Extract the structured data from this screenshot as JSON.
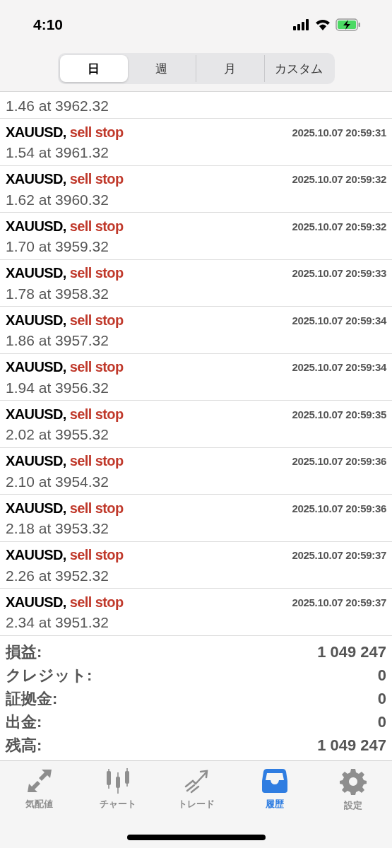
{
  "status_bar": {
    "time": "4:10"
  },
  "period_tabs": [
    {
      "label": "日",
      "selected": true
    },
    {
      "label": "週",
      "selected": false
    },
    {
      "label": "月",
      "selected": false
    },
    {
      "label": "カスタム",
      "selected": false
    }
  ],
  "orders": [
    {
      "details": "1.46 at 3962.32"
    },
    {
      "symbol": "XAUUSD,",
      "type": "sell stop",
      "time": "2025.10.07 20:59:31",
      "details": "1.54 at 3961.32"
    },
    {
      "symbol": "XAUUSD,",
      "type": "sell stop",
      "time": "2025.10.07 20:59:32",
      "details": "1.62 at 3960.32"
    },
    {
      "symbol": "XAUUSD,",
      "type": "sell stop",
      "time": "2025.10.07 20:59:32",
      "details": "1.70 at 3959.32"
    },
    {
      "symbol": "XAUUSD,",
      "type": "sell stop",
      "time": "2025.10.07 20:59:33",
      "details": "1.78 at 3958.32"
    },
    {
      "symbol": "XAUUSD,",
      "type": "sell stop",
      "time": "2025.10.07 20:59:34",
      "details": "1.86 at 3957.32"
    },
    {
      "symbol": "XAUUSD,",
      "type": "sell stop",
      "time": "2025.10.07 20:59:34",
      "details": "1.94 at 3956.32"
    },
    {
      "symbol": "XAUUSD,",
      "type": "sell stop",
      "time": "2025.10.07 20:59:35",
      "details": "2.02 at 3955.32"
    },
    {
      "symbol": "XAUUSD,",
      "type": "sell stop",
      "time": "2025.10.07 20:59:36",
      "details": "2.10 at 3954.32"
    },
    {
      "symbol": "XAUUSD,",
      "type": "sell stop",
      "time": "2025.10.07 20:59:36",
      "details": "2.18 at 3953.32"
    },
    {
      "symbol": "XAUUSD,",
      "type": "sell stop",
      "time": "2025.10.07 20:59:37",
      "details": "2.26 at 3952.32"
    },
    {
      "symbol": "XAUUSD,",
      "type": "sell stop",
      "time": "2025.10.07 20:59:37",
      "details": "2.34 at 3951.32"
    }
  ],
  "summary": [
    {
      "label": "損益:",
      "value": "1 049 247"
    },
    {
      "label": "クレジット:",
      "value": "0"
    },
    {
      "label": "証拠金:",
      "value": "0"
    },
    {
      "label": "出金:",
      "value": "0"
    },
    {
      "label": "残高:",
      "value": "1 049 247"
    }
  ],
  "tab_bar": [
    {
      "kind": "quotes",
      "label": "気配値",
      "selected": false
    },
    {
      "kind": "chart",
      "label": "チャート",
      "selected": false
    },
    {
      "kind": "trade",
      "label": "トレード",
      "selected": false
    },
    {
      "kind": "history",
      "label": "履歴",
      "selected": true
    },
    {
      "kind": "settings",
      "label": "設定",
      "selected": false
    }
  ]
}
